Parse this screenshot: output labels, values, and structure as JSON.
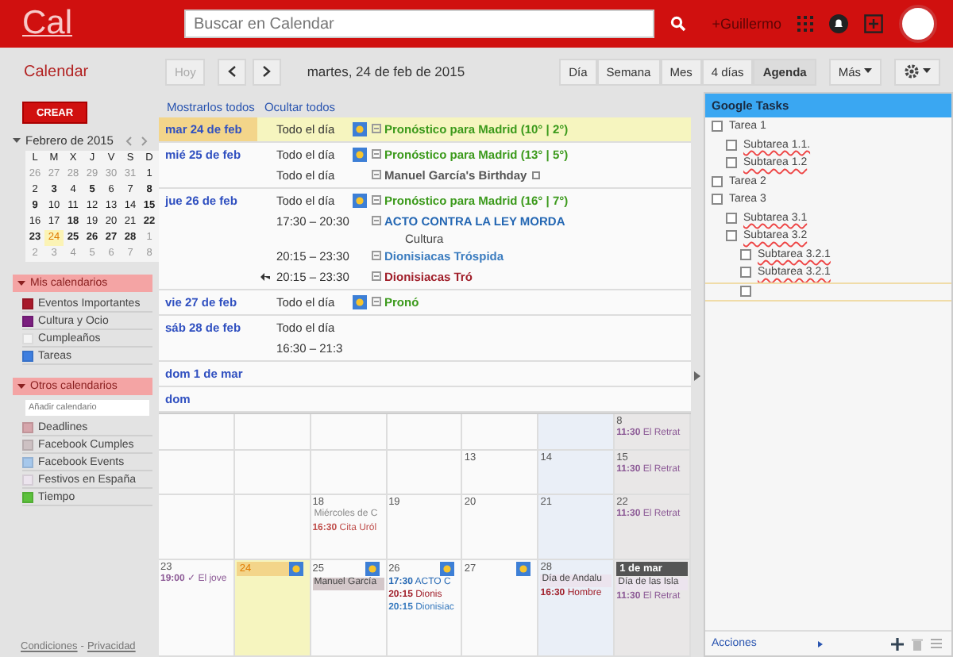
{
  "topbar": {
    "logo": "Cal",
    "search": {
      "placeholder": "Buscar en Calendar"
    },
    "user": "+Guillermo"
  },
  "toolbar": {
    "title": "Calendar",
    "today": {
      "label": "Hoy",
      "disabled": true
    },
    "date": "martes, 24 de feb de 2015",
    "views": [
      {
        "label": "Día",
        "selected": false
      },
      {
        "label": "Semana",
        "selected": false
      },
      {
        "label": "Mes",
        "selected": false
      },
      {
        "label": "4 días",
        "selected": false
      },
      {
        "label": "Agenda",
        "selected": true
      }
    ],
    "more": "Más"
  },
  "sidebar": {
    "create": "CREAR",
    "mini_calendar": {
      "month": "Febrero de 2015",
      "weekdays": [
        "L",
        "M",
        "X",
        "J",
        "V",
        "S",
        "D"
      ],
      "weeks": [
        [
          {
            "day": "26",
            "muted": true,
            "bold": false,
            "today": false
          },
          {
            "day": "27",
            "muted": true,
            "bold": false,
            "today": false
          },
          {
            "day": "28",
            "muted": true,
            "bold": false,
            "today": false
          },
          {
            "day": "29",
            "muted": true,
            "bold": false,
            "today": false
          },
          {
            "day": "30",
            "muted": true,
            "bold": false,
            "today": false
          },
          {
            "day": "31",
            "muted": true,
            "bold": false,
            "today": false
          },
          {
            "day": "1",
            "muted": false,
            "bold": false,
            "today": false
          }
        ],
        [
          {
            "day": "2",
            "muted": false,
            "bold": false,
            "today": false
          },
          {
            "day": "3",
            "muted": false,
            "bold": true,
            "today": false
          },
          {
            "day": "4",
            "muted": false,
            "bold": false,
            "today": false
          },
          {
            "day": "5",
            "muted": false,
            "bold": true,
            "today": false
          },
          {
            "day": "6",
            "muted": false,
            "bold": false,
            "today": false
          },
          {
            "day": "7",
            "muted": false,
            "bold": false,
            "today": false
          },
          {
            "day": "8",
            "muted": false,
            "bold": true,
            "today": false
          }
        ],
        [
          {
            "day": "9",
            "muted": false,
            "bold": true,
            "today": false
          },
          {
            "day": "10",
            "muted": false,
            "bold": false,
            "today": false
          },
          {
            "day": "11",
            "muted": false,
            "bold": false,
            "today": false
          },
          {
            "day": "12",
            "muted": false,
            "bold": false,
            "today": false
          },
          {
            "day": "13",
            "muted": false,
            "bold": false,
            "today": false
          },
          {
            "day": "14",
            "muted": false,
            "bold": false,
            "today": false
          },
          {
            "day": "15",
            "muted": false,
            "bold": true,
            "today": false
          }
        ],
        [
          {
            "day": "16",
            "muted": false,
            "bold": false,
            "today": false
          },
          {
            "day": "17",
            "muted": false,
            "bold": false,
            "today": false
          },
          {
            "day": "18",
            "muted": false,
            "bold": true,
            "today": false
          },
          {
            "day": "19",
            "muted": false,
            "bold": false,
            "today": false
          },
          {
            "day": "20",
            "muted": false,
            "bold": false,
            "today": false
          },
          {
            "day": "21",
            "muted": false,
            "bold": false,
            "today": false
          },
          {
            "day": "22",
            "muted": false,
            "bold": true,
            "today": false
          }
        ],
        [
          {
            "day": "23",
            "muted": false,
            "bold": true,
            "today": false
          },
          {
            "day": "24",
            "muted": false,
            "bold": false,
            "today": true
          },
          {
            "day": "25",
            "muted": false,
            "bold": true,
            "today": false
          },
          {
            "day": "26",
            "muted": false,
            "bold": true,
            "today": false
          },
          {
            "day": "27",
            "muted": false,
            "bold": true,
            "today": false
          },
          {
            "day": "28",
            "muted": false,
            "bold": true,
            "today": false
          },
          {
            "day": "1",
            "muted": true,
            "bold": false,
            "today": false
          }
        ],
        [
          {
            "day": "2",
            "muted": true,
            "bold": false,
            "today": false
          },
          {
            "day": "3",
            "muted": true,
            "bold": false,
            "today": false
          },
          {
            "day": "4",
            "muted": true,
            "bold": false,
            "today": false
          },
          {
            "day": "5",
            "muted": true,
            "bold": false,
            "today": false
          },
          {
            "day": "6",
            "muted": true,
            "bold": false,
            "today": false
          },
          {
            "day": "7",
            "muted": true,
            "bold": false,
            "today": false
          },
          {
            "day": "8",
            "muted": true,
            "bold": false,
            "today": false
          }
        ]
      ]
    },
    "my_calendars": {
      "title": "Mis calendarios",
      "items": [
        {
          "label": "Eventos Importantes",
          "color": "#a8192a"
        },
        {
          "label": "Cultura y Ocio",
          "color": "#7b1f7f"
        },
        {
          "label": "Cumpleaños",
          "color": "#f4f4f4"
        },
        {
          "label": "Tareas",
          "color": "#3f7fe0"
        }
      ]
    },
    "other_calendars": {
      "title": "Otros calendarios",
      "add": {
        "placeholder": "Añadir calendario"
      },
      "items": [
        {
          "label": "Deadlines",
          "color": "#d6a5ab"
        },
        {
          "label": "Facebook Cumples",
          "color": "#cdc1c3"
        },
        {
          "label": "Facebook Events",
          "color": "#a6c8ec"
        },
        {
          "label": "Festivos en España",
          "color": "#ece4ee"
        },
        {
          "label": "Tiempo",
          "color": "#5cc13c"
        }
      ]
    },
    "footer": [
      "Condiciones",
      "-",
      "Privacidad"
    ]
  },
  "agenda": {
    "actions": [
      "Mostrarlos todos",
      "Ocultar todos"
    ],
    "days": [
      {
        "date": "mar 24 de feb",
        "selected": true,
        "events": [
          {
            "time": "Todo el día",
            "title": "Pronóstico para Madrid (10° | 2°)",
            "weather": true,
            "color": "#3c9a1c",
            "replied": false,
            "linked": false
          }
        ]
      },
      {
        "date": "mié 25 de feb",
        "selected": false,
        "events": [
          {
            "time": "Todo el día",
            "title": "Pronóstico para Madrid (13° | 5°)",
            "weather": true,
            "color": "#3c9a1c",
            "replied": false,
            "linked": false
          },
          {
            "time": "Todo el día",
            "title": "Manuel García's Birthday",
            "weather": false,
            "color": "#555555",
            "replied": false,
            "linked": true
          }
        ]
      },
      {
        "date": "jue 26 de feb",
        "selected": false,
        "events": [
          {
            "time": "Todo el día",
            "title": "Pronóstico para Madrid (16° | 7°)",
            "weather": true,
            "color": "#3c9a1c",
            "replied": false,
            "linked": false
          },
          {
            "time": "17:30 – 20:30",
            "title": "ACTO CONTRA LA LEY MORDA",
            "subtitle": "Cultura",
            "weather": false,
            "color": "#2467b3",
            "replied": false,
            "linked": false
          },
          {
            "time": "20:15 – 23:30",
            "title": "Dionisiacas Tróspida",
            "weather": false,
            "color": "#3b7cbf",
            "replied": false,
            "linked": false
          },
          {
            "time": "20:15 – 23:30",
            "title": "Dionisiacas Tró",
            "weather": false,
            "color": "#a01f2a",
            "replied": true,
            "linked": false
          }
        ]
      },
      {
        "date": "vie 27 de feb",
        "selected": false,
        "events": [
          {
            "time": "Todo el día",
            "title": "Pronó",
            "weather": true,
            "color": "#3c9a1c",
            "replied": false,
            "linked": false
          }
        ]
      },
      {
        "date": "sáb 28 de feb",
        "selected": false,
        "events": [
          {
            "time": "Todo el día",
            "replied": false
          },
          {
            "time": "16:30 – 21:3",
            "replied": false
          }
        ]
      },
      {
        "date": "dom 1 de mar",
        "selected": false
      },
      {
        "date": "dom",
        "selected": false
      }
    ]
  },
  "month": {
    "weeks": [
      {
        "days": [
          {
            "day": "8",
            "events": [
              {
                "time": "11:30",
                "title": "El Retrat",
                "color": "#8c5a96"
              }
            ]
          }
        ]
      },
      {
        "days": [
          {
            "day": "13"
          },
          {
            "day": "14"
          },
          {
            "day": "15",
            "events": [
              {
                "time": "11:30",
                "title": "El Retrat",
                "color": "#8c5a96"
              }
            ]
          }
        ]
      },
      {
        "days": [
          {
            "day": "18",
            "allday": [
              {
                "title": "Miércoles de C",
                "color": "#8a8a8a",
                "filled": false
              }
            ],
            "events": [
              {
                "time": "16:30",
                "title": "Cita Uról",
                "color": "#c0504d"
              }
            ]
          },
          {
            "day": "19"
          },
          {
            "day": "20"
          },
          {
            "day": "21"
          },
          {
            "day": "22",
            "events": [
              {
                "time": "11:30",
                "title": "El Retrat",
                "color": "#8c5a96"
              }
            ]
          }
        ]
      },
      {
        "days": [
          {
            "day": "23",
            "events": [
              {
                "time": "19:00",
                "title": "✓ El jove",
                "color": "#8c5a96"
              }
            ]
          },
          {
            "day": "24",
            "today": true,
            "weather": true
          },
          {
            "day": "25",
            "weather": true,
            "allday": [
              {
                "title": "Manuel García",
                "color": "#d3c7c9",
                "filled": true
              }
            ]
          },
          {
            "day": "26",
            "weather": true,
            "events": [
              {
                "time": "17:30",
                "title": "ACTO C",
                "color": "#2467b3"
              },
              {
                "time": "20:15",
                "title": "Dionis",
                "color": "#a01f2a"
              },
              {
                "time": "20:15",
                "title": "Dionisiac",
                "color": "#3b7cbf"
              }
            ]
          },
          {
            "day": "27",
            "weather": true
          },
          {
            "day": "28",
            "allday": [
              {
                "title": "Día de Andalu",
                "color": "#ece4ee",
                "filled": true
              }
            ],
            "events": [
              {
                "time": "16:30",
                "title": "Hombre",
                "color": "#a01f2a"
              }
            ]
          },
          {
            "day": "1 de mar",
            "month_start": true,
            "allday": [
              {
                "title": "Día de las Isla",
                "color": "#ece4ee",
                "filled": true
              }
            ],
            "events": [
              {
                "time": "11:30",
                "title": "El Retrat",
                "color": "#8c5a96"
              }
            ]
          }
        ]
      }
    ]
  },
  "tasks": {
    "title": "Google Tasks",
    "items": [
      {
        "title": "Tarea 1",
        "checked": false,
        "children": [
          {
            "title": "Subtarea 1.1.",
            "checked": false
          },
          {
            "title": "Subtarea 1.2",
            "checked": false
          }
        ]
      },
      {
        "title": "Tarea 2",
        "checked": false
      },
      {
        "title": "Tarea 3",
        "checked": false,
        "children": [
          {
            "title": "Subtarea 3.1",
            "checked": false
          },
          {
            "title": "Subtarea 3.2",
            "checked": false,
            "children": [
              {
                "title": "Subtarea 3.2.1",
                "checked": false
              },
              {
                "title": "Subtarea 3.2.1",
                "checked": false
              },
              {
                "checked": false,
                "editing": true
              }
            ]
          }
        ]
      }
    ],
    "actions": "Acciones"
  }
}
